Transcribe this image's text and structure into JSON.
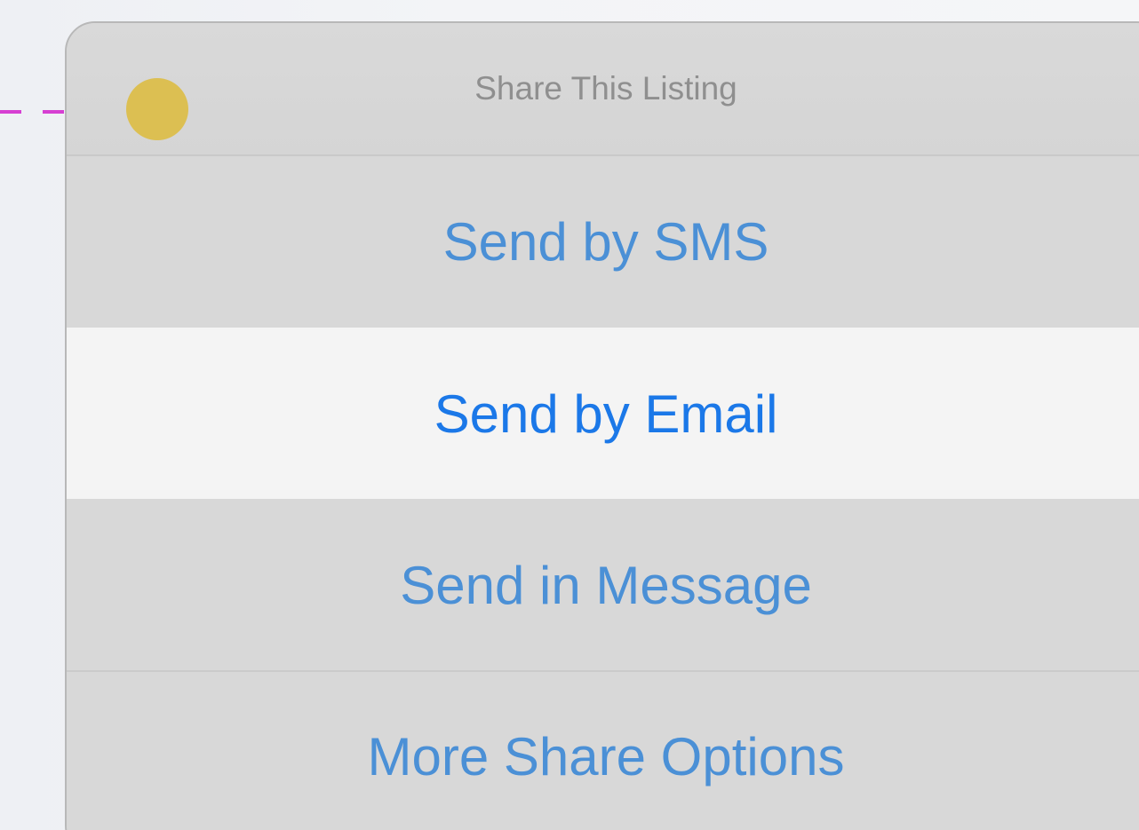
{
  "action_sheet": {
    "title": "Share This Listing",
    "actions": [
      {
        "label": "Send by SMS",
        "highlighted": false
      },
      {
        "label": "Send by Email",
        "highlighted": true
      },
      {
        "label": "Send in Message",
        "highlighted": false
      },
      {
        "label": "More Share Options",
        "highlighted": false
      }
    ]
  },
  "annotation": {
    "connector_color": "#d63fd2",
    "marker_color": "#dcbf52"
  },
  "colors": {
    "action_text": "#4b90d6",
    "action_text_highlighted": "#1b78e8",
    "title_text": "#8f8f8f",
    "sheet_background": "#d6d6d6",
    "highlight_background": "#f4f4f4"
  }
}
